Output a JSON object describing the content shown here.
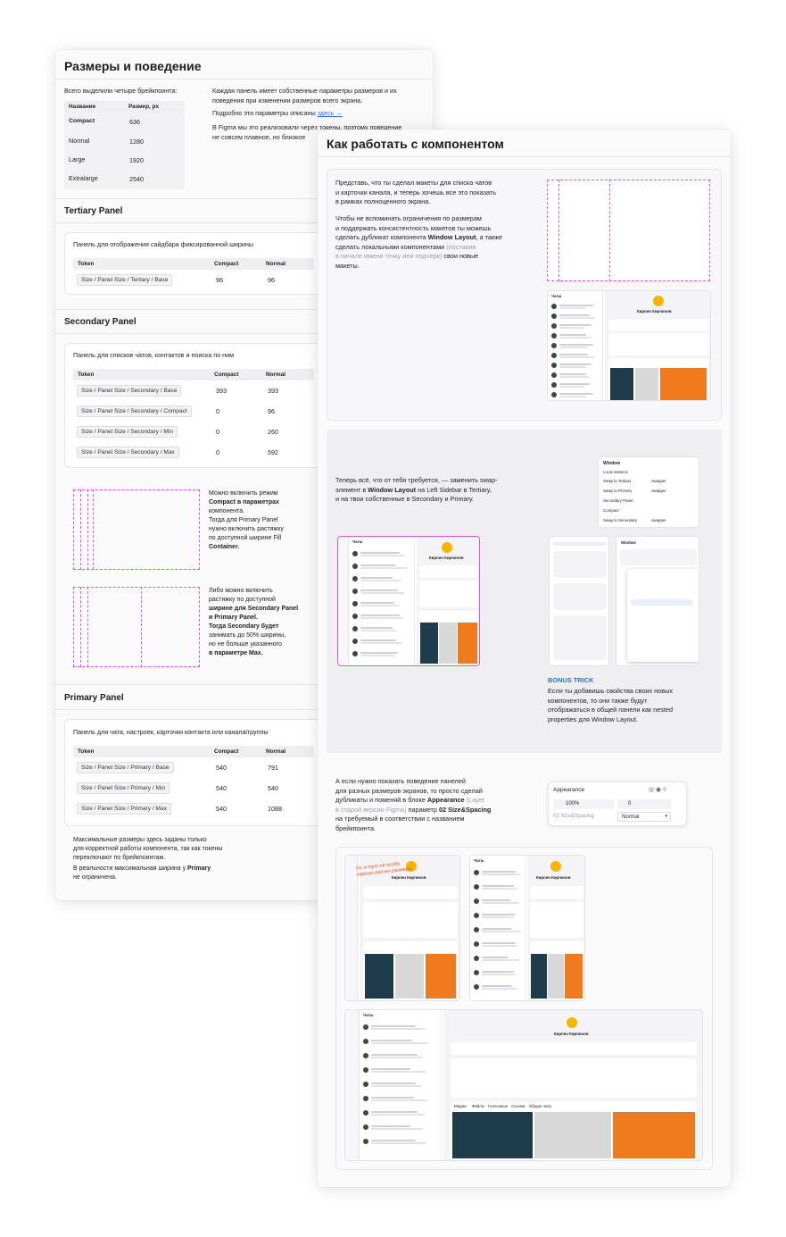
{
  "sizes": {
    "title": "Размеры и поведение",
    "intro": "Всего выделили четыре брейкпоинта:",
    "table_headers": [
      "Название",
      "Размер, px"
    ],
    "rows": [
      {
        "name": "Compact",
        "size": "636"
      },
      {
        "name": "Normal",
        "size": "1280"
      },
      {
        "name": "Large",
        "size": "1920"
      },
      {
        "name": "Extralarge",
        "size": "2540"
      }
    ],
    "right_p1": "Каждая панель имеет собственные параметры размеров и их поведения при изменении размеров всего экрана.",
    "right_p2_prefix": "Подробно эти параметры описаны ",
    "right_p2_link": "здесь →",
    "right_p3": "В Figma мы это реализовали через токены, поэтому поведение не совсем плавное, но близкое"
  },
  "tertiary": {
    "title": "Tertiary Panel",
    "desc": "Панель для отображения сайдбара фиксированной ширины",
    "headers": [
      "Token",
      "Compact",
      "Normal"
    ],
    "rows": [
      {
        "token": "Size / Panel Size / Tertiary / Base",
        "compact": "96",
        "normal": "96"
      }
    ]
  },
  "secondary": {
    "title": "Secondary Panel",
    "desc": "Панель для списков чатов, контактов и поиска по ним",
    "headers": [
      "Token",
      "Compact",
      "Normal"
    ],
    "rows": [
      {
        "token": "Size / Panel Size / Secondary / Base",
        "compact": "393",
        "normal": "393"
      },
      {
        "token": "Size / Panel Size / Secondary / Compact",
        "compact": "0",
        "normal": "96"
      },
      {
        "token": "Size / Panel Size / Secondary / Min",
        "compact": "0",
        "normal": "260"
      },
      {
        "token": "Size / Panel Size / Secondary / Max",
        "compact": "0",
        "normal": "592"
      }
    ],
    "note1": [
      "Можно включить режим",
      "Compact в параметрах",
      "компонента.",
      "Тогда для Primary Panel",
      "нужно включить растяжку",
      "по доступной ширине Fill",
      "Container."
    ],
    "note2": [
      "Либо можно включить",
      "растяжку по доступной",
      "ширине для Secondary Panel",
      "и Primary Panel.",
      "Тогда Secondary будет",
      "занимать до 50% ширины,",
      "но не больше указанного",
      "в параметре Max."
    ]
  },
  "primary": {
    "title": "Primary Panel",
    "desc": "Панель для чата, настроек, карточки контакта или канала/группы",
    "headers": [
      "Token",
      "Compact",
      "Normal"
    ],
    "rows": [
      {
        "token": "Size / Panel Size / Primary / Base",
        "compact": "540",
        "normal": "791"
      },
      {
        "token": "Size / Panel Size / Primary / Min",
        "compact": "540",
        "normal": "540"
      },
      {
        "token": "Size / Panel Size / Primary / Max",
        "compact": "540",
        "normal": "1088"
      }
    ],
    "footer1": [
      "Максимальные размеры здесь заданы только",
      "для корректной работы компонента, так как токены",
      "переключают по брейкпоинтам."
    ],
    "footer2_prefix": "В реальности максимальная ширина у ",
    "footer2_bold": "Primary",
    "footer2_suffix": "не ограничена."
  },
  "howto": {
    "title": "Как работать с компонентом",
    "s1_p1": [
      "Представь, что ты сделал макеты для списка чатов",
      "и карточки канала, и теперь хочешь все это показать",
      "в рамках полноценного экрана."
    ],
    "s1_p2_lines": [
      "Чтобы не вспоминать ограничения по размерам",
      "и поддержать консистентность макетов ты можешь"
    ],
    "s1_p2_line3_prefix": "сделать дубликат компонента ",
    "s1_p2_line3_bold": "Window Layout",
    "s1_p2_line3_suffix": ", а также",
    "s1_p2_line4_prefix": "сделать локальными компонентами ",
    "s1_p2_line4_muted": "(поставив",
    "s1_p2_line5_muted": "в начале имени точку или подчерк)",
    "s1_p2_line5_suffix": " свои новые",
    "s1_p2_line6": "макеты.",
    "s2_line1": "Теперь всё, что от тебя требуется, — заменить swap-",
    "s2_line2_prefix": "элемент в ",
    "s2_line2_bold": "Window Layout",
    "s2_line2_suffix": " на Left Sidebar в Tertiary,",
    "s2_line3": "и на твои собственные в Secondary и Primary.",
    "bonus_title": "BONUS TRICK",
    "bonus_text": [
      "Если ты добавишь свойства своих новых",
      "компонентов, то они также будут",
      "отображаться в общей панели как nested",
      "properties для Window Layout."
    ],
    "s3_line1": "А если нужно показать поведение панелей",
    "s3_line2": "для разных размеров экранов, то просто сделай",
    "s3_line3_prefix": "дубликаты и поменяй в блоке ",
    "s3_line3_bold": "Appearance",
    "s3_line3_muted": " (Layer",
    "s3_line4_muted": "в старой версии Figma)",
    "s3_line4_suffix": " параметр ",
    "s3_line4_bold": "02 Size&Spacing",
    "s3_line5": "на требуемый в соответствии с названием",
    "s3_line6": "брейкпоинта.",
    "appearance": {
      "title": "Appearance",
      "opacity": "100%",
      "radius": "0",
      "row_label": "02 Size&Spacing",
      "row_value": "Normal"
    },
    "window_panel": {
      "title": "Window",
      "rows": [
        "Local instance",
        "Swap to Tertiary",
        "Swap to Primary",
        "Secondary Panel",
        "Compact",
        "Swap to Secondary"
      ],
      "value": ".swapper"
    },
    "mock": {
      "chats": "Чаты",
      "name": "Кирпич Кирпичов",
      "tabs": [
        "Медиа",
        "Файлы",
        "Голосовые",
        "Ссылки",
        "Общие чаты"
      ],
      "annotation": "да, я тут не особо хорошо расчел размеры"
    }
  },
  "colors": {
    "accent": "#2d6be6",
    "guide": "#d957d9"
  }
}
